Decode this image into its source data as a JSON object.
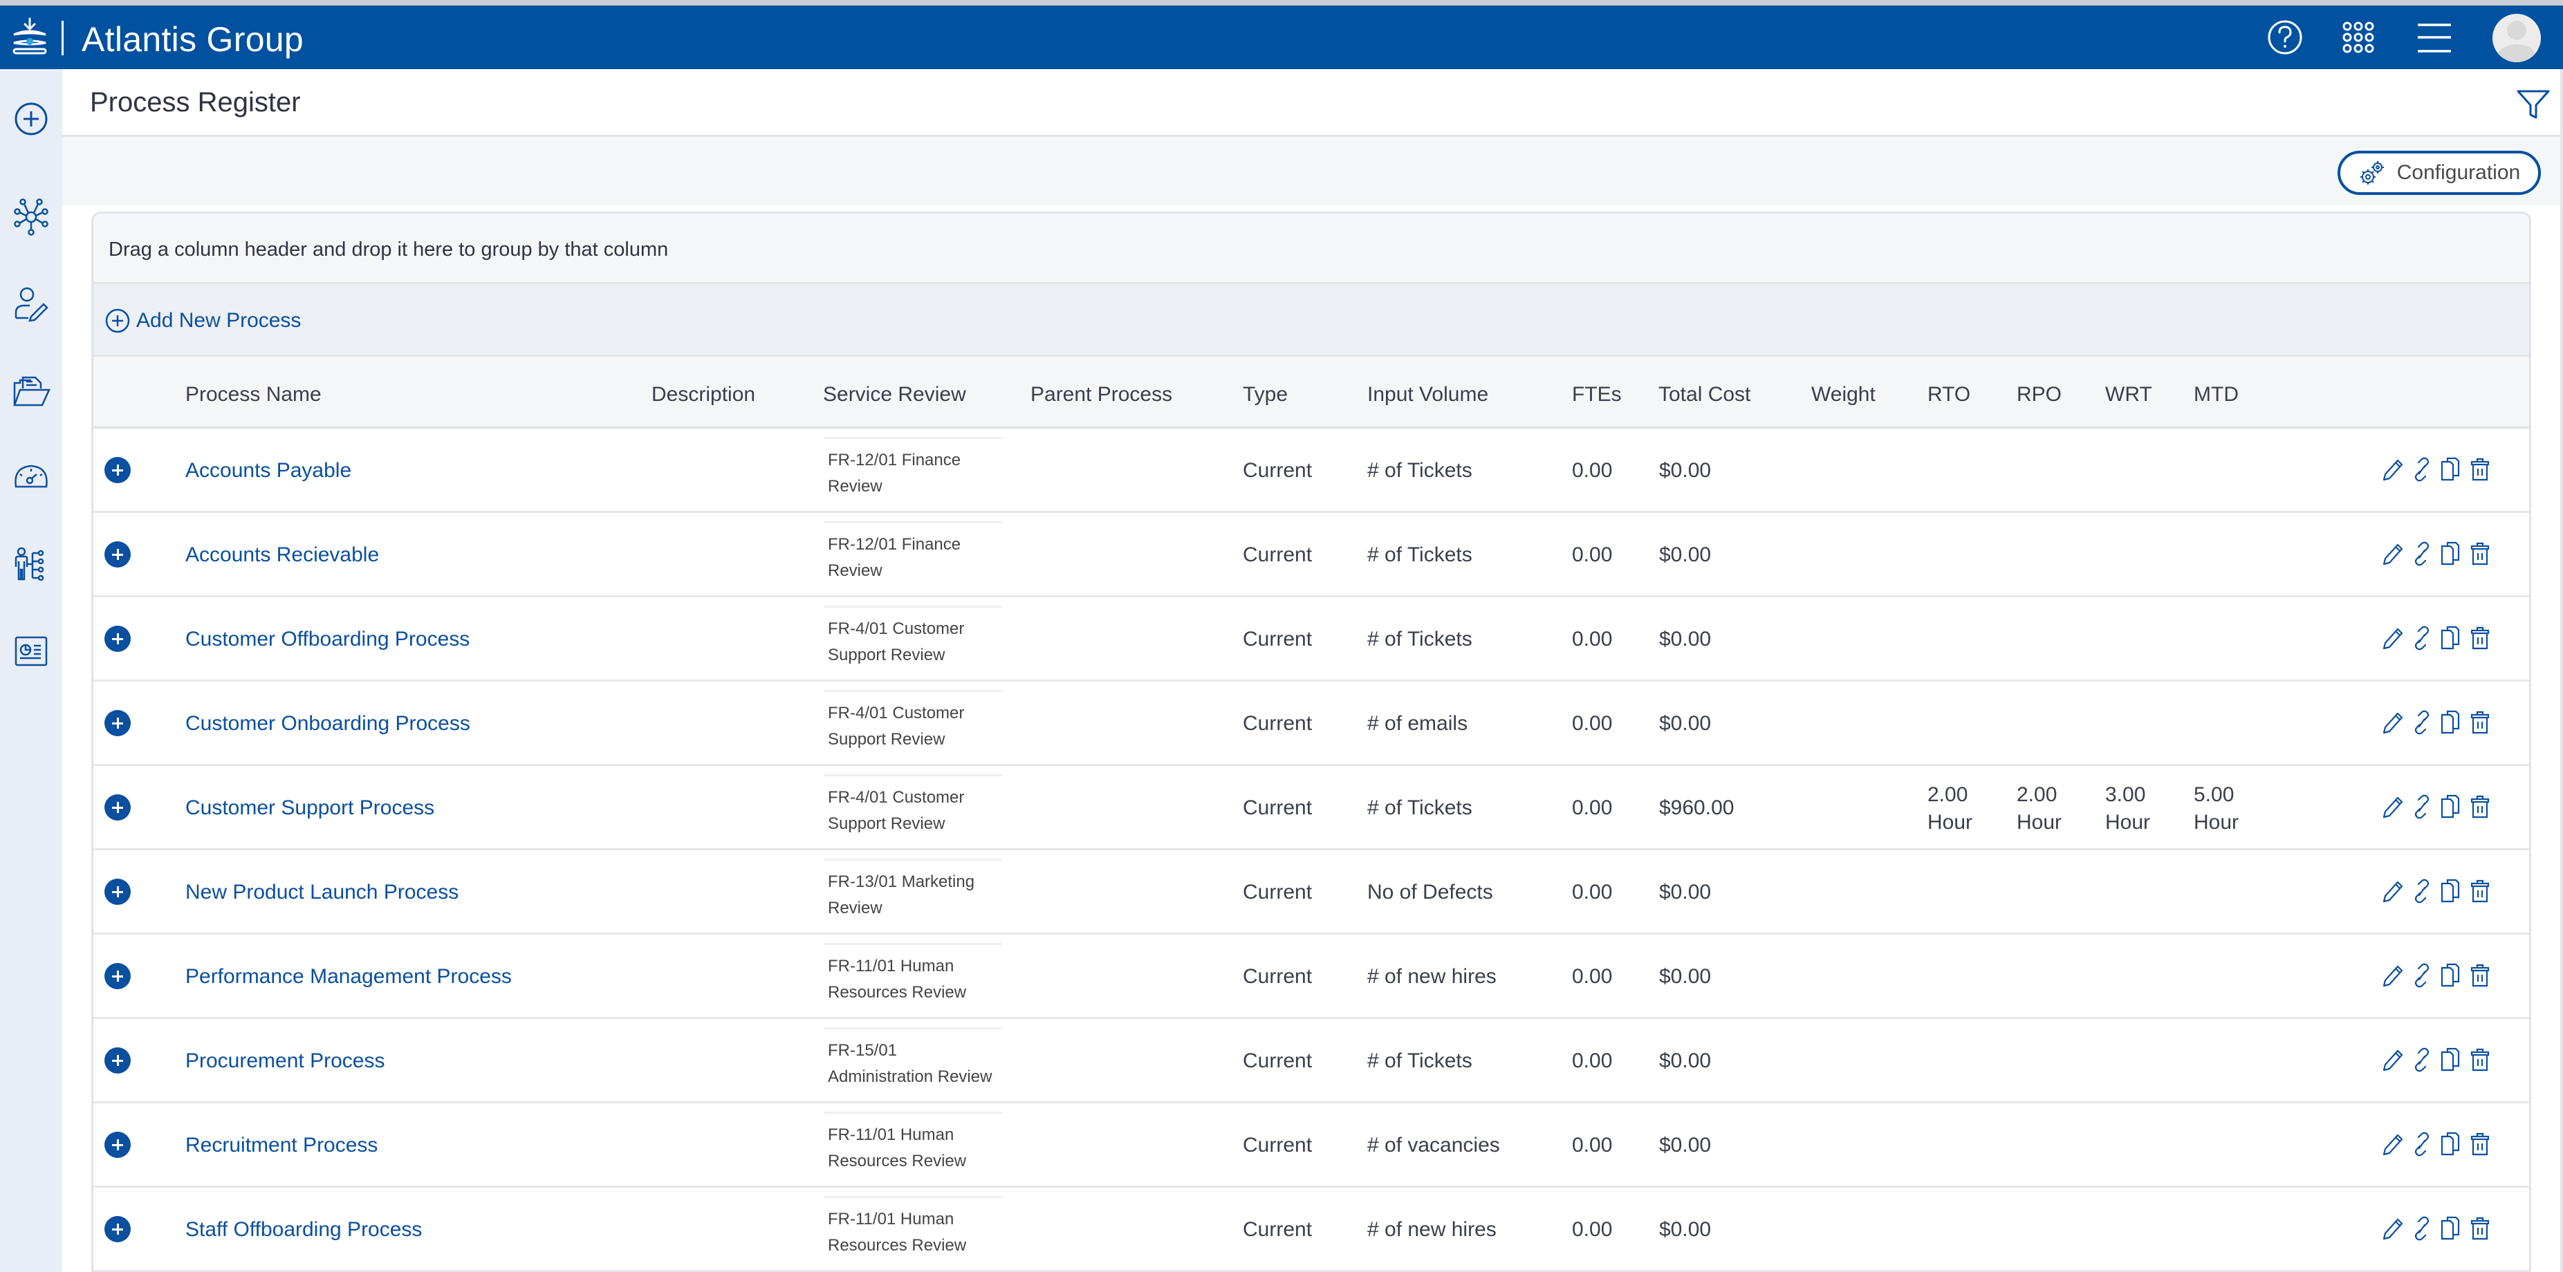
{
  "app": {
    "title": "Atlantis Group",
    "header_icons": [
      "help-icon",
      "apps-grid-icon",
      "menu-icon",
      "user-avatar"
    ]
  },
  "sidebar": {
    "items": [
      {
        "icon": "add-circle-icon",
        "label": "Add"
      },
      {
        "icon": "network-icon",
        "label": "Network"
      },
      {
        "icon": "user-edit-icon",
        "label": "User Edit"
      },
      {
        "icon": "folder-open-icon",
        "label": "Documents"
      },
      {
        "icon": "gauge-icon",
        "label": "Dashboard"
      },
      {
        "icon": "org-person-icon",
        "label": "Organization"
      },
      {
        "icon": "report-chart-icon",
        "label": "Reports"
      }
    ]
  },
  "page": {
    "title": "Process Register",
    "configuration_label": "Configuration"
  },
  "grid": {
    "group_panel_text": "Drag a column header and drop it here to group by that column",
    "add_new_label": "Add New Process",
    "columns": [
      "Process Name",
      "Description",
      "Service Review",
      "Parent Process",
      "Type",
      "Input Volume",
      "FTEs",
      "Total Cost",
      "Weight",
      "RTO",
      "RPO",
      "WRT",
      "MTD"
    ],
    "rows": [
      {
        "name": "Accounts Payable",
        "description": "",
        "service_review": "FR-12/01 Finance Review",
        "parent": "",
        "type": "Current",
        "input_volume": "# of Tickets",
        "ftes": "0.00",
        "total_cost": "$0.00",
        "weight": "",
        "rto": "",
        "rpo": "",
        "wrt": "",
        "mtd": ""
      },
      {
        "name": "Accounts Recievable",
        "description": "",
        "service_review": "FR-12/01 Finance Review",
        "parent": "",
        "type": "Current",
        "input_volume": "# of Tickets",
        "ftes": "0.00",
        "total_cost": "$0.00",
        "weight": "",
        "rto": "",
        "rpo": "",
        "wrt": "",
        "mtd": ""
      },
      {
        "name": "Customer Offboarding Process",
        "description": "",
        "service_review": "FR-4/01 Customer Support Review",
        "parent": "",
        "type": "Current",
        "input_volume": "# of Tickets",
        "ftes": "0.00",
        "total_cost": "$0.00",
        "weight": "",
        "rto": "",
        "rpo": "",
        "wrt": "",
        "mtd": ""
      },
      {
        "name": "Customer Onboarding Process",
        "description": "",
        "service_review": "FR-4/01 Customer Support Review",
        "parent": "",
        "type": "Current",
        "input_volume": "# of emails",
        "ftes": "0.00",
        "total_cost": "$0.00",
        "weight": "",
        "rto": "",
        "rpo": "",
        "wrt": "",
        "mtd": ""
      },
      {
        "name": "Customer Support Process",
        "description": "",
        "service_review": "FR-4/01 Customer Support Review",
        "parent": "",
        "type": "Current",
        "input_volume": "# of Tickets",
        "ftes": "0.00",
        "total_cost": "$960.00",
        "weight": "",
        "rto": "2.00 Hour",
        "rpo": "2.00 Hour",
        "wrt": "3.00 Hour",
        "mtd": "5.00 Hour"
      },
      {
        "name": "New Product Launch Process",
        "description": "",
        "service_review": "FR-13/01 Marketing Review",
        "parent": "",
        "type": "Current",
        "input_volume": "No of Defects",
        "ftes": "0.00",
        "total_cost": "$0.00",
        "weight": "",
        "rto": "",
        "rpo": "",
        "wrt": "",
        "mtd": ""
      },
      {
        "name": "Performance Management Process",
        "description": "",
        "service_review": "FR-11/01 Human Resources Review",
        "parent": "",
        "type": "Current",
        "input_volume": "# of new hires",
        "ftes": "0.00",
        "total_cost": "$0.00",
        "weight": "",
        "rto": "",
        "rpo": "",
        "wrt": "",
        "mtd": ""
      },
      {
        "name": "Procurement Process",
        "description": "",
        "service_review": "FR-15/01 Administration Review",
        "parent": "",
        "type": "Current",
        "input_volume": "# of Tickets",
        "ftes": "0.00",
        "total_cost": "$0.00",
        "weight": "",
        "rto": "",
        "rpo": "",
        "wrt": "",
        "mtd": ""
      },
      {
        "name": "Recruitment Process",
        "description": "",
        "service_review": "FR-11/01 Human Resources Review",
        "parent": "",
        "type": "Current",
        "input_volume": "# of vacancies",
        "ftes": "0.00",
        "total_cost": "$0.00",
        "weight": "",
        "rto": "",
        "rpo": "",
        "wrt": "",
        "mtd": ""
      },
      {
        "name": "Staff Offboarding Process",
        "description": "",
        "service_review": "FR-11/01 Human Resources Review",
        "parent": "",
        "type": "Current",
        "input_volume": "# of new hires",
        "ftes": "0.00",
        "total_cost": "$0.00",
        "weight": "",
        "rto": "",
        "rpo": "",
        "wrt": "",
        "mtd": ""
      }
    ],
    "row_actions": [
      "edit-icon",
      "link-icon",
      "copy-icon",
      "delete-icon"
    ]
  },
  "colors": {
    "brand": "#0051a0",
    "link": "#0a4fa0",
    "sidebar_bg": "#e9eef6"
  }
}
